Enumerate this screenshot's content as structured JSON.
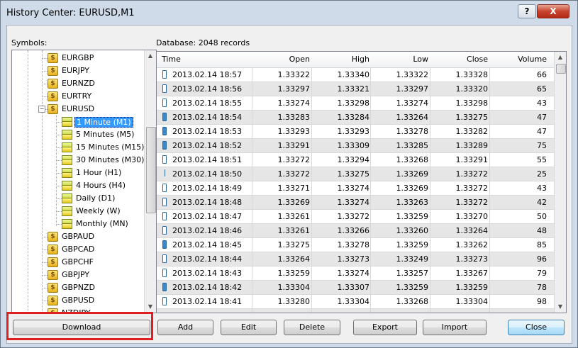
{
  "window": {
    "title": "History Center: EURUSD,M1",
    "help_label": "?",
    "close_label": "X"
  },
  "symbols_label": "Symbols:",
  "database_label": "Database: 2048 records",
  "tree": {
    "items": [
      {
        "label": "EURGBP",
        "kind": "symbol",
        "expanded": false
      },
      {
        "label": "EURJPY",
        "kind": "symbol",
        "expanded": false
      },
      {
        "label": "EURNZD",
        "kind": "symbol",
        "expanded": false
      },
      {
        "label": "EURTRY",
        "kind": "symbol",
        "expanded": false
      },
      {
        "label": "EURUSD",
        "kind": "symbol",
        "expanded": true
      },
      {
        "label": "1 Minute (M1)",
        "kind": "timeframe",
        "selected": true
      },
      {
        "label": "5 Minutes (M5)",
        "kind": "timeframe"
      },
      {
        "label": "15 Minutes (M15)",
        "kind": "timeframe"
      },
      {
        "label": "30 Minutes (M30)",
        "kind": "timeframe"
      },
      {
        "label": "1 Hour (H1)",
        "kind": "timeframe"
      },
      {
        "label": "4 Hours (H4)",
        "kind": "timeframe"
      },
      {
        "label": "Daily (D1)",
        "kind": "timeframe"
      },
      {
        "label": "Weekly (W)",
        "kind": "timeframe"
      },
      {
        "label": "Monthly (MN)",
        "kind": "timeframe"
      },
      {
        "label": "GBPAUD",
        "kind": "symbol",
        "expanded": false
      },
      {
        "label": "GBPCAD",
        "kind": "symbol",
        "expanded": false
      },
      {
        "label": "GBPCHF",
        "kind": "symbol",
        "expanded": false
      },
      {
        "label": "GBPJPY",
        "kind": "symbol",
        "expanded": false
      },
      {
        "label": "GBPNZD",
        "kind": "symbol",
        "expanded": false
      },
      {
        "label": "GBPUSD",
        "kind": "symbol",
        "expanded": false
      },
      {
        "label": "NZDJPY",
        "kind": "symbol",
        "expanded": false
      }
    ]
  },
  "table": {
    "columns": [
      "Time",
      "Open",
      "High",
      "Low",
      "Close",
      "Volume"
    ],
    "rows": [
      {
        "icon": "hollow",
        "time": "2013.02.14 18:57",
        "open": "1.33322",
        "high": "1.33340",
        "low": "1.33322",
        "close": "1.33328",
        "volume": "66"
      },
      {
        "icon": "hollow",
        "time": "2013.02.14 18:56",
        "open": "1.33297",
        "high": "1.33321",
        "low": "1.33297",
        "close": "1.33320",
        "volume": "65"
      },
      {
        "icon": "hollow",
        "time": "2013.02.14 18:55",
        "open": "1.33274",
        "high": "1.33298",
        "low": "1.33274",
        "close": "1.33298",
        "volume": "43"
      },
      {
        "icon": "filled",
        "time": "2013.02.14 18:54",
        "open": "1.33283",
        "high": "1.33284",
        "low": "1.33264",
        "close": "1.33275",
        "volume": "47"
      },
      {
        "icon": "filled",
        "time": "2013.02.14 18:53",
        "open": "1.33293",
        "high": "1.33293",
        "low": "1.33278",
        "close": "1.33282",
        "volume": "47"
      },
      {
        "icon": "filled",
        "time": "2013.02.14 18:52",
        "open": "1.33291",
        "high": "1.33309",
        "low": "1.33285",
        "close": "1.33289",
        "volume": "75"
      },
      {
        "icon": "hollow",
        "time": "2013.02.14 18:51",
        "open": "1.33272",
        "high": "1.33294",
        "low": "1.33268",
        "close": "1.33291",
        "volume": "55"
      },
      {
        "icon": "tick",
        "time": "2013.02.14 18:50",
        "open": "1.33272",
        "high": "1.33275",
        "low": "1.33269",
        "close": "1.33272",
        "volume": "25"
      },
      {
        "icon": "hollow",
        "time": "2013.02.14 18:49",
        "open": "1.33271",
        "high": "1.33274",
        "low": "1.33269",
        "close": "1.33272",
        "volume": "43"
      },
      {
        "icon": "hollow",
        "time": "2013.02.14 18:48",
        "open": "1.33269",
        "high": "1.33274",
        "low": "1.33263",
        "close": "1.33272",
        "volume": "42"
      },
      {
        "icon": "hollow",
        "time": "2013.02.14 18:47",
        "open": "1.33261",
        "high": "1.33272",
        "low": "1.33259",
        "close": "1.33270",
        "volume": "50"
      },
      {
        "icon": "hollow",
        "time": "2013.02.14 18:46",
        "open": "1.33261",
        "high": "1.33266",
        "low": "1.33260",
        "close": "1.33264",
        "volume": "48"
      },
      {
        "icon": "filled",
        "time": "2013.02.14 18:45",
        "open": "1.33275",
        "high": "1.33278",
        "low": "1.33259",
        "close": "1.33262",
        "volume": "85"
      },
      {
        "icon": "hollow",
        "time": "2013.02.14 18:44",
        "open": "1.33264",
        "high": "1.33273",
        "low": "1.33249",
        "close": "1.33273",
        "volume": "96"
      },
      {
        "icon": "hollow",
        "time": "2013.02.14 18:43",
        "open": "1.33259",
        "high": "1.33274",
        "low": "1.33257",
        "close": "1.33267",
        "volume": "79"
      },
      {
        "icon": "filled",
        "time": "2013.02.14 18:42",
        "open": "1.33304",
        "high": "1.33307",
        "low": "1.33259",
        "close": "1.33259",
        "volume": "78"
      },
      {
        "icon": "hollow",
        "time": "2013.02.14 18:41",
        "open": "1.33280",
        "high": "1.33304",
        "low": "1.33268",
        "close": "1.33304",
        "volume": "98"
      }
    ]
  },
  "buttons": {
    "download": "Download",
    "add": "Add",
    "edit": "Edit",
    "delete": "Delete",
    "export": "Export",
    "import": "Import",
    "close": "Close"
  },
  "colors": {
    "highlight_box": "#e02020",
    "selection": "#3399ff",
    "candle": "#2a6aa0"
  }
}
